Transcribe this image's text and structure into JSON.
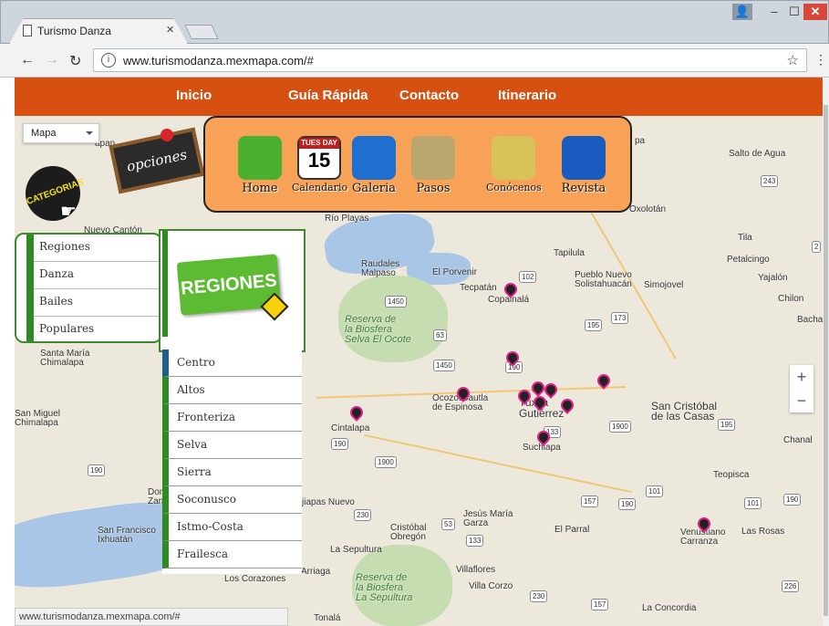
{
  "browser": {
    "tab_title": "Turismo Danza",
    "tab_close": "×",
    "url": "www.turismodanza.mexmapa.com/#",
    "status_url": "www.turismodanza.mexmapa.com/#"
  },
  "navbar": {
    "items": [
      {
        "label": "Inicio"
      },
      {
        "label": "Guía Rápida"
      },
      {
        "label": "Contacto"
      },
      {
        "label": "Itinerario"
      }
    ],
    "color": "#d85011"
  },
  "map_type": {
    "selected": "Mapa"
  },
  "widgets": {
    "opciones": "opciones",
    "categorias": "CATEGORIAS"
  },
  "panel": {
    "items": [
      {
        "label": "Home",
        "icon": "home-icon",
        "color": "#4bb030"
      },
      {
        "label": "Calendario",
        "icon": "calendar-icon",
        "color": "#ffffff",
        "badge_top": "TUES DAY",
        "badge_number": "15"
      },
      {
        "label": "Galeria",
        "icon": "sunflower-icon",
        "color": "#1e6fd0"
      },
      {
        "label": "Pasos",
        "icon": "map-icon",
        "color": "#b9a76f"
      },
      {
        "label": "Conócenos",
        "icon": "notepad-icon",
        "color": "#d8c35a"
      },
      {
        "label": "Revista",
        "icon": "book-icon",
        "color": "#1a5bc0"
      }
    ]
  },
  "categories": {
    "items": [
      {
        "label": "Regiones"
      },
      {
        "label": "Danza"
      },
      {
        "label": "Bailes"
      },
      {
        "label": "Populares"
      }
    ]
  },
  "regiones_sign": "REGIONES",
  "regions": {
    "items": [
      {
        "label": "Centro"
      },
      {
        "label": "Altos"
      },
      {
        "label": "Fronteriza"
      },
      {
        "label": "Selva"
      },
      {
        "label": "Sierra"
      },
      {
        "label": "Soconusco"
      },
      {
        "label": "Istmo-Costa"
      },
      {
        "label": "Frailesca"
      }
    ]
  },
  "map_labels": {
    "salto_de_agua": "Salto de Agua",
    "oxolotan": "Oxolotán",
    "pa": "pa",
    "apan": "apan",
    "rio_playas": "Río Playas",
    "nuevo_canton": "Nuevo Cantón",
    "tapilula": "Tapilula",
    "tila": "Tila",
    "petalcingo": "Petalcingo",
    "yajalon": "Yajalón",
    "chilon": "Chilon",
    "bacha": "Bacha",
    "raudales": "Raudales\nMalpaso",
    "el_porvenir": "El Porvenir",
    "tecpatan": "Tecpatán",
    "copainala": "Copainalá",
    "pueblo_nuevo": "Pueblo Nuevo\nSolistahuacán",
    "simojovel": "Simojovel",
    "ocote": "Reserva de\nla Biosfera\nSelva El Ocote",
    "santa_maria": "Santa María\nChimalapa",
    "ocozocoautla": "Ocozocoautla\nde Espinosa",
    "tuxtla": "Tuxtla\nGutiérrez",
    "san_cristobal": "San Cristóbal\nde las Casas",
    "chanal": "Chanal",
    "san_miguel": "San Miguel\nChimalapa",
    "cintalapa": "Cintalapa",
    "suchiapa": "Suchiapa",
    "teopisca": "Teopisca",
    "dom_zana": "Don\nZana",
    "jiapas_nuevo": "jiapas Nuevo",
    "jesus_maria": "Jesús María\nGarza",
    "san_francisco": "San Francisco\nIxhuatán",
    "cristobal_obregon": "Cristóbal\nObregón",
    "el_parral": "El Parral",
    "venustiano": "Venustiano\nCarranza",
    "las_rosas": "Las Rosas",
    "la_sepultura": "La Sepultura",
    "villaflores": "Villaflores",
    "villa_corzo": "Villa Corzo",
    "los_corazones": "Los Corazones",
    "arriaga": "Arriaga",
    "reserva_sepultura": "Reserva de\nla Biosfera\nLa Sepultura",
    "la_concordia": "La Concordia",
    "tonala": "Tonalá"
  },
  "shields": [
    "243",
    "102",
    "1450",
    "195",
    "173",
    "63",
    "1450",
    "190",
    "1900",
    "195",
    "133",
    "190",
    "190",
    "1900",
    "230",
    "157",
    "190",
    "101",
    "101",
    "190",
    "53",
    "133",
    "230",
    "157",
    "226",
    "2"
  ],
  "zoom": {
    "in": "+",
    "out": "−"
  },
  "colors": {
    "accent_green": "#2f8a24",
    "panel_orange": "#f7a256",
    "marker_pink": "#e0208a"
  }
}
